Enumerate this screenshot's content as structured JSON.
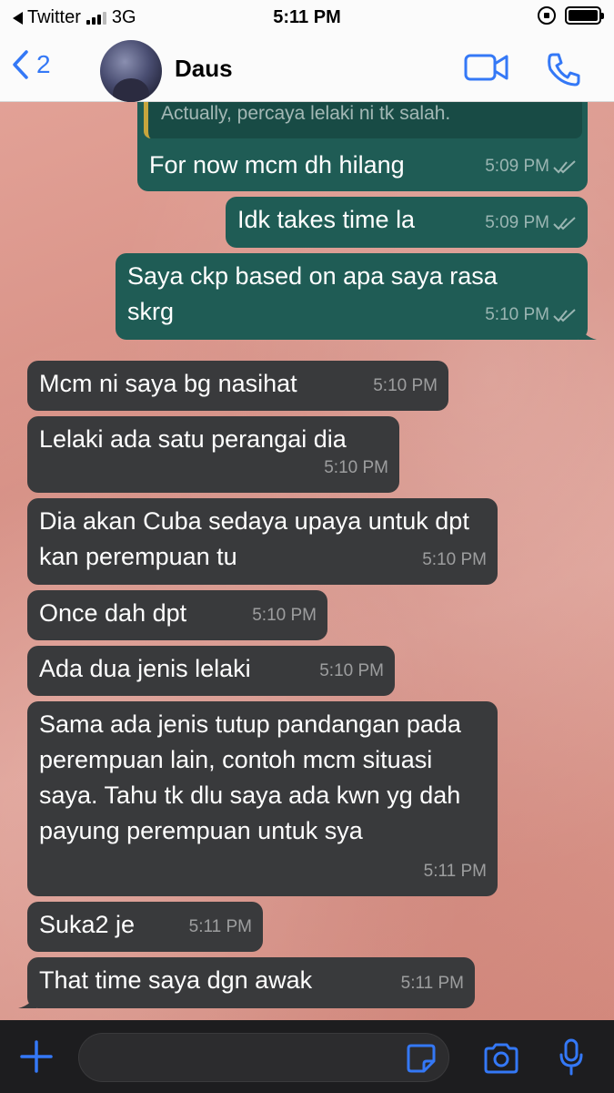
{
  "status_bar": {
    "back_app": "Twitter",
    "network": "3G",
    "time": "5:11 PM"
  },
  "header": {
    "back_count": "2",
    "contact_name": "Daus"
  },
  "quoted_message": "Actually, percaya lelaki ni tk salah.",
  "messages": [
    {
      "direction": "out",
      "text": "For now mcm dh hilang",
      "time": "5:09 PM",
      "status": "read"
    },
    {
      "direction": "out",
      "text": "Idk takes time la",
      "time": "5:09 PM",
      "status": "read"
    },
    {
      "direction": "out",
      "text": "Saya ckp based on apa saya rasa skrg",
      "time": "5:10 PM",
      "status": "read"
    },
    {
      "direction": "in",
      "text": "Mcm ni saya bg nasihat",
      "time": "5:10 PM"
    },
    {
      "direction": "in",
      "text": "Lelaki ada satu perangai dia",
      "time": "5:10 PM"
    },
    {
      "direction": "in",
      "text": "Dia akan Cuba sedaya upaya untuk dpt kan perempuan tu",
      "time": "5:10 PM"
    },
    {
      "direction": "in",
      "text": "Once dah dpt",
      "time": "5:10 PM"
    },
    {
      "direction": "in",
      "text": "Ada dua jenis lelaki",
      "time": "5:10 PM"
    },
    {
      "direction": "in",
      "text": "Sama ada jenis tutup pandangan pada perempuan lain, contoh mcm situasi saya. Tahu tk dlu saya ada kwn yg dah payung perempuan untuk sya",
      "time": "5:11 PM"
    },
    {
      "direction": "in",
      "text": "Suka2 je",
      "time": "5:11 PM"
    },
    {
      "direction": "in",
      "text": "That time saya dgn awak",
      "time": "5:11 PM"
    }
  ],
  "input": {
    "placeholder": ""
  },
  "colors": {
    "outgoing_bubble": "#1f5c55",
    "incoming_bubble": "#393a3c",
    "accent": "#3478f6"
  },
  "icons": [
    "chevron-left-icon",
    "video-call-icon",
    "phone-icon",
    "plus-icon",
    "sticker-icon",
    "camera-icon",
    "microphone-icon",
    "read-ticks-icon"
  ]
}
